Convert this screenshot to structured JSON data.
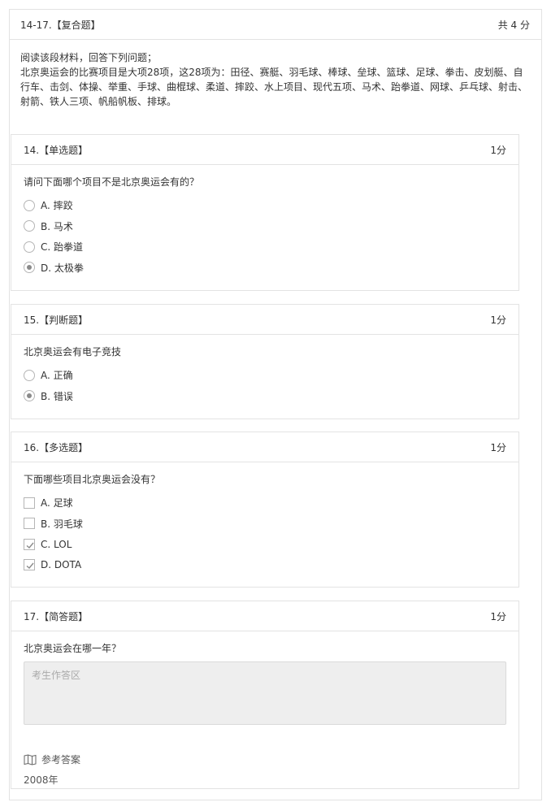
{
  "group": {
    "title": "14-17.【复合题】",
    "score": "共 4 分",
    "material_line1": "阅读该段材料，回答下列问题；",
    "material_line2": "北京奥运会的比赛项目是大项28项，这28项为：田径、赛艇、羽毛球、棒球、垒球、篮球、足球、拳击、皮划艇、自行车、击剑、体操、举重、手球、曲棍球、柔道、摔跤、水上项目、现代五项、马术、跆拳道、网球、乒乓球、射击、射箭、铁人三项、帆船帆板、排球。"
  },
  "questions": [
    {
      "title": "14.【单选题】",
      "score": "1分",
      "text": "请问下面哪个项目不是北京奥运会有的？",
      "options": [
        {
          "label": "A. 摔跤",
          "checked": false
        },
        {
          "label": "B. 马术",
          "checked": false
        },
        {
          "label": "C. 跆拳道",
          "checked": false
        },
        {
          "label": "D. 太极拳",
          "checked": true
        }
      ]
    },
    {
      "title": "15.【判断题】",
      "score": "1分",
      "text": "北京奥运会有电子竞技",
      "options": [
        {
          "label": "A. 正确",
          "checked": false
        },
        {
          "label": "B. 错误",
          "checked": true
        }
      ]
    },
    {
      "title": "16.【多选题】",
      "score": "1分",
      "text": "下面哪些项目北京奥运会没有？",
      "options": [
        {
          "label": "A. 足球",
          "checked": false
        },
        {
          "label": "B. 羽毛球",
          "checked": false
        },
        {
          "label": "C. LOL",
          "checked": true
        },
        {
          "label": "D. DOTA",
          "checked": true
        }
      ]
    },
    {
      "title": "17.【简答题】",
      "score": "1分",
      "text": "北京奥运会在哪一年？",
      "placeholder": "考生作答区",
      "reference_label": "参考答案",
      "reference_answer": "2008年"
    }
  ],
  "icons": {
    "reference": "book-icon"
  },
  "colors": {
    "border": "#e3e3e3",
    "text": "#333333",
    "answer_bg": "#eeeeee",
    "checked_mark": "#8a8a8a"
  }
}
